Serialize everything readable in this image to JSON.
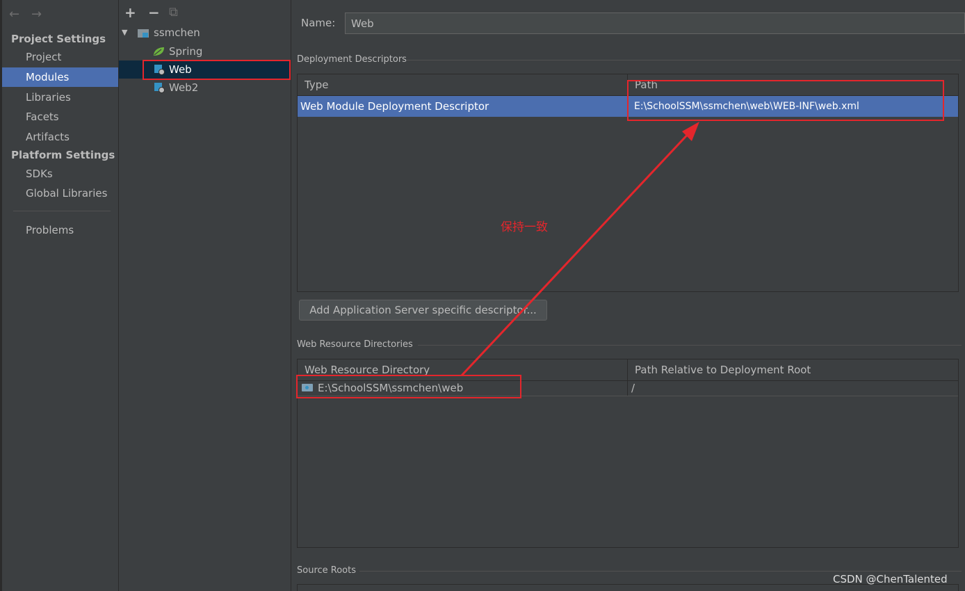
{
  "left_nav": {
    "back_glyph": "←",
    "forward_glyph": "→",
    "project_settings_title": "Project Settings",
    "project_settings_items": [
      "Project",
      "Modules",
      "Libraries",
      "Facets",
      "Artifacts"
    ],
    "selected_item": "Modules",
    "platform_settings_title": "Platform Settings",
    "platform_settings_items": [
      "SDKs",
      "Global Libraries"
    ],
    "problems_label": "Problems"
  },
  "toolbar": {
    "add_glyph": "+",
    "remove_glyph": "−",
    "copy_glyph": "⧉"
  },
  "tree": {
    "root_label": "ssmchen",
    "expand_glyph": "▼",
    "children": [
      {
        "label": "Spring",
        "icon": "spring-leaf-icon"
      },
      {
        "label": "Web",
        "icon": "web-module-icon",
        "selected": true
      },
      {
        "label": "Web2",
        "icon": "web-module-icon"
      }
    ]
  },
  "name_field": {
    "label": "Name:",
    "value": "Web"
  },
  "deployment_descriptors": {
    "title": "Deployment Descriptors",
    "columns": [
      "Type",
      "Path"
    ],
    "rows": [
      {
        "type": "Web Module Deployment Descriptor",
        "path": "E:\\SchoolSSM\\ssmchen\\web\\WEB-INF\\web.xml"
      }
    ]
  },
  "add_descriptor_button": "Add Application Server specific descriptor...",
  "web_resource_directories": {
    "title": "Web Resource Directories",
    "columns": [
      "Web Resource Directory",
      "Path Relative to Deployment Root"
    ],
    "rows": [
      {
        "directory": "E:\\SchoolSSM\\ssmchen\\web",
        "relative_path": "/"
      }
    ]
  },
  "source_roots_title": "Source Roots",
  "annotation_text": "保持一致",
  "watermark": "CSDN @ChenTalented",
  "colors": {
    "background": "#3c3f41",
    "selection_blue": "#4b6eaf",
    "tree_selection": "#0d293e",
    "annotation_red": "#e4262c",
    "spring_green": "#6db33f",
    "module_blue": "#3592c4"
  }
}
